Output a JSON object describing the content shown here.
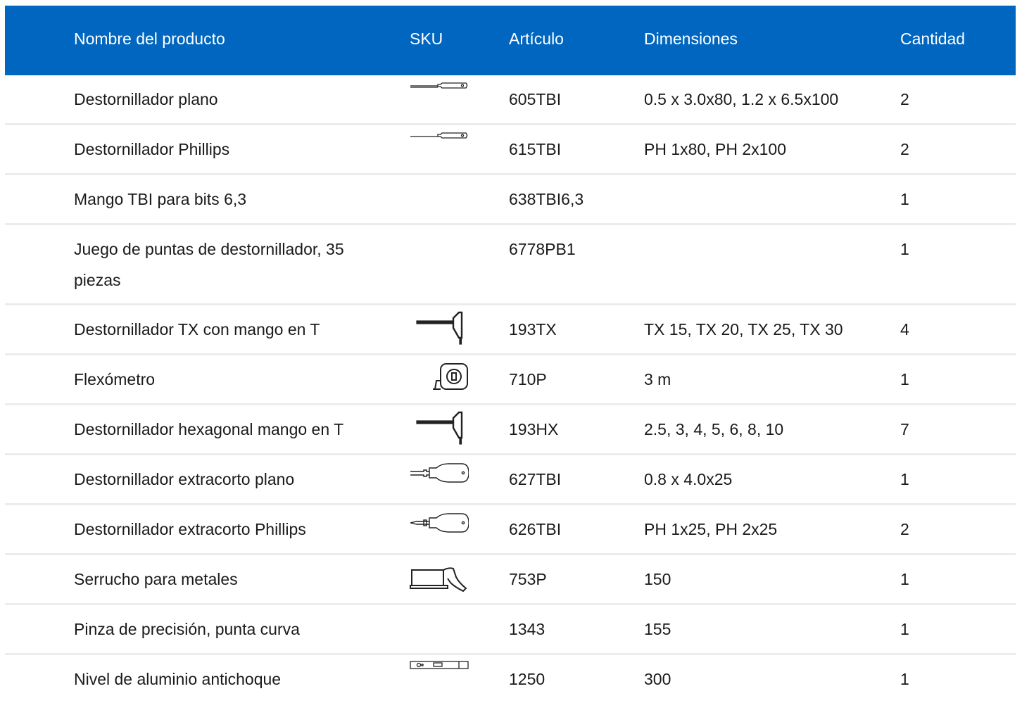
{
  "table": {
    "headers": {
      "name": "Nombre del producto",
      "sku": "SKU",
      "article": "Artículo",
      "dimensions": "Dimensiones",
      "quantity": "Cantidad"
    },
    "rows": [
      {
        "name": "Destornillador plano",
        "icon": "flat-screwdriver-icon",
        "article": "605TBI",
        "dimensions": "0.5 x 3.0x80, 1.2 x 6.5x100",
        "quantity": "2"
      },
      {
        "name": "Destornillador Phillips",
        "icon": "phillips-screwdriver-icon",
        "article": "615TBI",
        "dimensions": "PH 1x80, PH 2x100",
        "quantity": "2"
      },
      {
        "name": "Mango TBI para bits 6,3",
        "icon": "",
        "article": "638TBI6,3",
        "dimensions": "",
        "quantity": "1"
      },
      {
        "name": "Juego de puntas de destornillador, 35 piezas",
        "icon": "",
        "article": "6778PB1",
        "dimensions": "",
        "quantity": "1"
      },
      {
        "name": "Destornillador TX con mango en T",
        "icon": "t-handle-torx-icon",
        "article": "193TX",
        "dimensions": "TX 15, TX 20, TX 25, TX 30",
        "quantity": "4"
      },
      {
        "name": "Flexómetro",
        "icon": "tape-measure-icon",
        "article": "710P",
        "dimensions": "3 m",
        "quantity": "1"
      },
      {
        "name": "Destornillador hexagonal mango en T",
        "icon": "t-handle-hex-icon",
        "article": "193HX",
        "dimensions": "2.5, 3, 4, 5, 6, 8, 10",
        "quantity": "7"
      },
      {
        "name": "Destornillador extracorto plano",
        "icon": "stubby-flat-screwdriver-icon",
        "article": "627TBI",
        "dimensions": "0.8 x 4.0x25",
        "quantity": "1"
      },
      {
        "name": "Destornillador extracorto Phillips",
        "icon": "stubby-phillips-screwdriver-icon",
        "article": "626TBI",
        "dimensions": "PH 1x25, PH 2x25",
        "quantity": "2"
      },
      {
        "name": "Serrucho para metales",
        "icon": "hacksaw-icon",
        "article": "753P",
        "dimensions": "150",
        "quantity": "1"
      },
      {
        "name": "Pinza de precisión, punta curva",
        "icon": "",
        "article": "1343",
        "dimensions": "155",
        "quantity": "1"
      },
      {
        "name": "Nivel de aluminio antichoque",
        "icon": "spirit-level-icon",
        "article": "1250",
        "dimensions": "300",
        "quantity": "1"
      }
    ]
  },
  "colors": {
    "header_background": "#0066bf",
    "header_text": "#ffffff",
    "row_divider": "#ececec",
    "body_text": "#1a1a1a"
  }
}
